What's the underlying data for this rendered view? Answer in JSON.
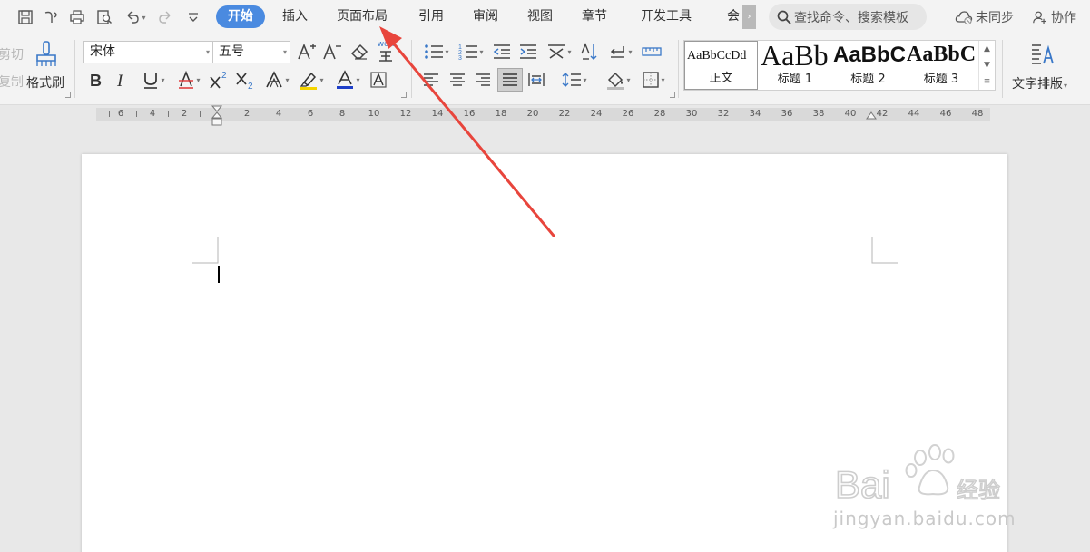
{
  "menubar": {
    "tabs": [
      {
        "label": "开始",
        "active": true
      },
      {
        "label": "插入"
      },
      {
        "label": "页面布局"
      },
      {
        "label": "引用"
      },
      {
        "label": "审阅"
      },
      {
        "label": "视图"
      },
      {
        "label": "章节"
      },
      {
        "label": "开发工具"
      },
      {
        "label": "会"
      }
    ],
    "overflow_glyph": "›",
    "search_placeholder": "查找命令、搜索模板",
    "sync_label": "未同步",
    "collab_label": "协作"
  },
  "ribbon": {
    "cut_label": "剪切",
    "copy_label": "复制",
    "format_painter_label": "格式刷",
    "font_name": "宋体",
    "font_size": "五号",
    "phonetic_glyph": "wén",
    "style_gallery": [
      {
        "sample": "AaBbCcDd",
        "name": "正文",
        "active": true
      },
      {
        "sample": "AaBb",
        "name": "标题 1"
      },
      {
        "sample": "AaBbC",
        "name": "标题 2"
      },
      {
        "sample": "AaBbC",
        "name": "标题 3"
      }
    ],
    "text_layout_label": "文字排版"
  },
  "ruler": {
    "labels_left": [
      "6",
      "4",
      "2"
    ],
    "labels_right": [
      "2",
      "4",
      "6",
      "8",
      "10",
      "12",
      "14",
      "16",
      "18",
      "20",
      "22",
      "24",
      "26",
      "28",
      "30",
      "32",
      "34",
      "36",
      "38",
      "40",
      "42",
      "44",
      "46",
      "48"
    ]
  },
  "watermark": {
    "brand": "Bai du 经验",
    "url": "jingyan.baidu.com"
  },
  "colors": {
    "active_tab": "#4a8ae0",
    "arrow": "#e8453c",
    "font_color_underline": "#1e3fc8",
    "highlight_underline": "#f5d400"
  }
}
